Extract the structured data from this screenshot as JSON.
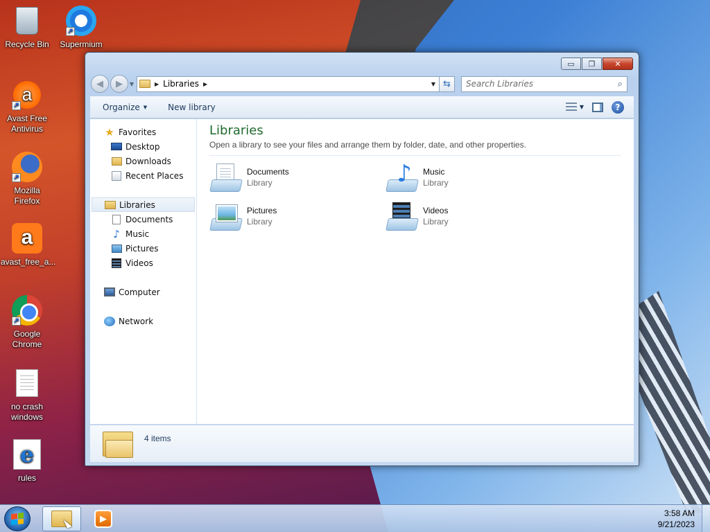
{
  "desktop": {
    "icons": [
      {
        "label": "Recycle Bin",
        "icon": "recycle-bin-icon"
      },
      {
        "label": "Supermium",
        "icon": "supermium-icon"
      },
      {
        "label": "Avast Free Antivirus",
        "icon": "avast-icon"
      },
      {
        "label": "Mozilla Firefox",
        "icon": "firefox-icon"
      },
      {
        "label": "avast_free_a...",
        "icon": "avast-installer-icon"
      },
      {
        "label": "Google Chrome",
        "icon": "chrome-icon"
      },
      {
        "label": "no crash windows",
        "icon": "text-file-icon"
      },
      {
        "label": "rules",
        "icon": "internet-explorer-icon"
      }
    ]
  },
  "window": {
    "address": {
      "crumb": "Libraries"
    },
    "search": {
      "placeholder": "Search Libraries"
    },
    "commands": {
      "organize": "Organize",
      "new_library": "New library"
    },
    "caption": {
      "minimize": "▭",
      "maximize": "❐",
      "close": "✕"
    }
  },
  "navpane": {
    "favorites": {
      "label": "Favorites",
      "items": [
        "Desktop",
        "Downloads",
        "Recent Places"
      ]
    },
    "libraries": {
      "label": "Libraries",
      "items": [
        "Documents",
        "Music",
        "Pictures",
        "Videos"
      ]
    },
    "computer": "Computer",
    "network": "Network"
  },
  "content": {
    "title": "Libraries",
    "subtitle": "Open a library to see your files and arrange them by folder, date, and other properties.",
    "libraries": [
      {
        "name": "Documents",
        "type": "Library",
        "icon": "documents-library-icon"
      },
      {
        "name": "Music",
        "type": "Library",
        "icon": "music-library-icon"
      },
      {
        "name": "Pictures",
        "type": "Library",
        "icon": "pictures-library-icon"
      },
      {
        "name": "Videos",
        "type": "Library",
        "icon": "videos-library-icon"
      }
    ]
  },
  "details": {
    "item_count": "4 items"
  },
  "taskbar": {
    "time": "3:58 AM",
    "date": "9/21/2023"
  }
}
